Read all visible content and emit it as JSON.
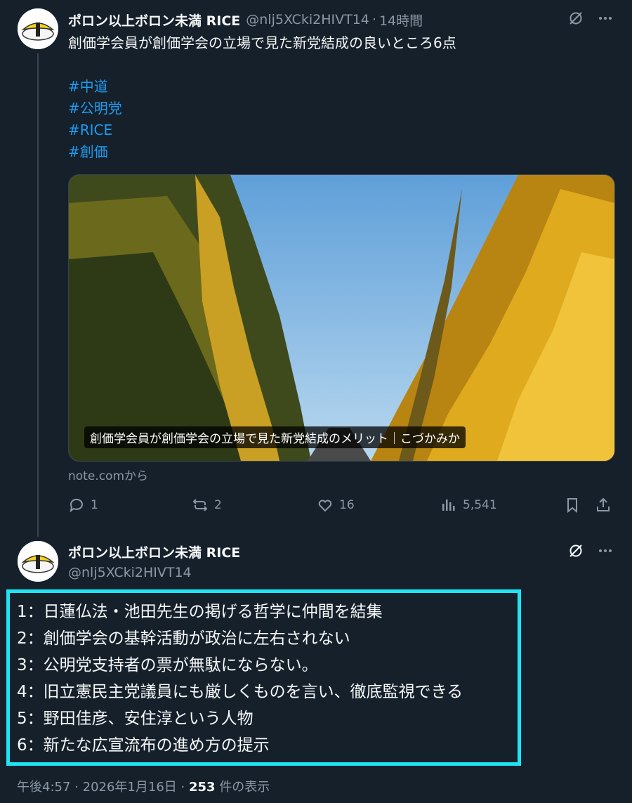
{
  "tweet1": {
    "display_name": "ポロン以上ボロン未満 RICE",
    "handle": "@nlj5XCki2HIVT14",
    "separator": "·",
    "time_ago": "14時間",
    "text": "創価学会員が創価学会の立場で見た新党結成の良いところ6点",
    "hashtags": [
      "#中道",
      "#公明党",
      "#RICE",
      "#創価"
    ],
    "card_caption": "創価学会員が創価学会の立場で見た新党結成のメリット｜こづかみか",
    "card_source": "note.comから",
    "actions": {
      "replies": "1",
      "retweets": "2",
      "likes": "16",
      "views": "5,541"
    }
  },
  "tweet2": {
    "display_name": "ポロン以上ボロン未満 RICE",
    "handle": "@nlj5XCki2HIVT14",
    "lines": [
      "1：日蓮仏法・池田先生の掲げる哲学に仲間を結集",
      "2：創価学会の基幹活動が政治に左右されない",
      "3：公明党支持者の票が無駄にならない。",
      "4：旧立憲民主党議員にも厳しくものを言い、徹底監視できる",
      "5：野田佳彦、安住淳という人物",
      "6：新たな広宣流布の進め方の提示"
    ],
    "time": "午後4:57",
    "date": "2026年1月16日",
    "views_count": "253",
    "views_label": "件の表示",
    "separator": "·"
  },
  "colors": {
    "background": "#15202b",
    "link": "#1d9bf0",
    "muted": "#8b98a5",
    "highlight_border": "#1fe4f4"
  },
  "icons": [
    "grok-icon",
    "more-icon",
    "reply-icon",
    "retweet-icon",
    "like-icon",
    "views-icon",
    "bookmark-icon",
    "share-icon"
  ]
}
